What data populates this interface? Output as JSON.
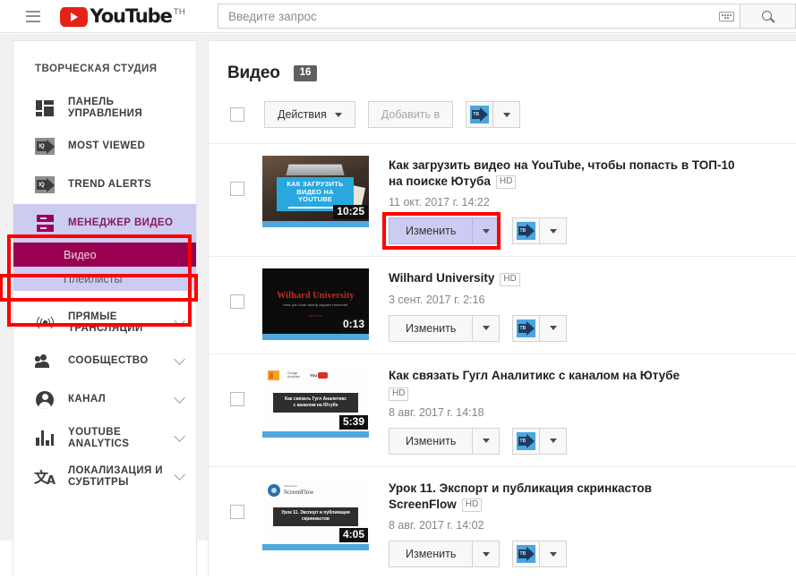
{
  "header": {
    "menu_icon": "hamburger-menu-icon",
    "logo_text": "YouTube",
    "logo_country": "TH",
    "search": {
      "placeholder": "Введите запрос",
      "value": "",
      "keyboard_icon": "keyboard-icon",
      "search_icon": "search-icon"
    }
  },
  "sidebar": {
    "title": "ТВОРЧЕСКАЯ СТУДИЯ",
    "items": [
      {
        "label": "ПАНЕЛЬ УПРАВЛЕНИЯ",
        "icon": "dashboard-icon",
        "expandable": false
      },
      {
        "label": "MOST VIEWED",
        "icon": "iq-arrow-icon",
        "expandable": false
      },
      {
        "label": "TREND ALERTS",
        "icon": "iq-arrow-icon",
        "expandable": false
      },
      {
        "label": "МЕНЕДЖЕР ВИДЕО",
        "icon": "video-manager-icon",
        "expandable": false
      },
      {
        "label": "ПРЯМЫЕ ТРАНСЛЯЦИИ",
        "icon": "live-broadcast-icon",
        "expandable": true
      },
      {
        "label": "СООБЩЕСТВО",
        "icon": "community-people-icon",
        "expandable": true
      },
      {
        "label": "КАНАЛ",
        "icon": "channel-person-icon",
        "expandable": true
      },
      {
        "label": "YOUTUBE ANALYTICS",
        "icon": "analytics-bars-icon",
        "expandable": true
      },
      {
        "label": "ЛОКАЛИЗАЦИЯ И\nСУБТИТРЫ",
        "icon": "translate-icon",
        "expandable": true
      }
    ],
    "video_manager_sub": [
      {
        "label": "Видео",
        "active": true
      },
      {
        "label": "Плейлисты",
        "active": false
      }
    ],
    "highlight_color": "#fe0000",
    "active_sub_bg": "#97014f",
    "block_bg": "#ccccf2"
  },
  "main": {
    "title": "Видео",
    "count": "16",
    "toolbar": {
      "select_all_checkbox": "",
      "actions_label": "Действия",
      "add_to_label": "Добавить в",
      "blue_icon": "blue-play-badge-icon"
    },
    "videos": [
      {
        "title": "Как загрузить видео на YouTube, чтобы попасть в ТОП-10 на поиске Ютуба",
        "hd": "HD",
        "date": "11 окт. 2017 г. 14:22",
        "duration": "10:25",
        "edit_label": "Изменить",
        "highlighted": true,
        "thumb_kind": "desk",
        "thumb_text": [
          "КАК ЗАГРУЗИТЬ",
          "ВИДЕО НА",
          "YOUTUBE"
        ]
      },
      {
        "title": "Wilhard University",
        "hd": "HD",
        "date": "3 сент. 2017 г. 2:16",
        "duration": "0:13",
        "edit_label": "Изменить",
        "highlighted": false,
        "thumb_kind": "wilhard",
        "thumb_text": [
          "Wilhard University",
          "how you look nicely argued reserved",
          "wilhard.ru"
        ]
      },
      {
        "title": "Как связать Гугл Аналитикс с каналом на Ютубе",
        "hd": "HD",
        "date": "8 авг. 2017 г. 14:18",
        "duration": "5:39",
        "edit_label": "Изменить",
        "highlighted": false,
        "thumb_kind": "analytics",
        "thumb_text": [
          "Как связать Гугл Аналитикс",
          "с каналом на Ютубе"
        ]
      },
      {
        "title": "Урок 11. Экспорт и публикация скринкастов ScreenFlow",
        "hd": "HD",
        "date": "8 авг. 2017 г. 14:02",
        "duration": "4:05",
        "edit_label": "Изменить",
        "highlighted": false,
        "thumb_kind": "screenflow",
        "thumb_text": [
          "Урок 11. Экспорт и публикация",
          "скринкастов"
        ],
        "thumb_logo": "ScreenFlow"
      }
    ]
  }
}
